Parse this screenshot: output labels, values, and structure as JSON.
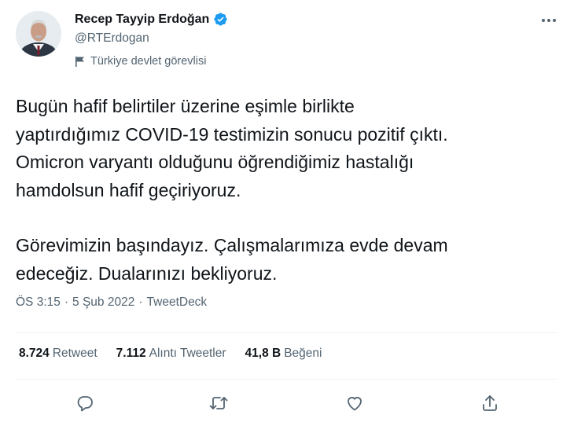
{
  "author": {
    "display_name": "Recep Tayyip Erdoğan",
    "handle": "@RTErdogan",
    "label": "Türkiye devlet görevlisi",
    "verified_icon": "verified-badge-icon",
    "label_icon": "flag-icon"
  },
  "tweet": {
    "lines_p1": [
      "Bugün hafif belirtiler üzerine eşimle birlikte",
      "yaptırdığımız COVID-19 testimizin sonucu pozitif çıktı.",
      "Omicron varyantı olduğunu öğrendiğimiz hastalığı",
      "hamdolsun hafif geçiriyoruz."
    ],
    "lines_p2": [
      "Görevimizin başındayız. Çalışmalarımıza evde devam",
      "edeceğiz. Dualarınızı bekliyoruz."
    ]
  },
  "meta": {
    "time": "ÖS 3:15",
    "separator": "·",
    "date": "5 Şub 2022",
    "source": "TweetDeck"
  },
  "stats": {
    "retweets_count": "8.724",
    "retweets_label": "Retweet",
    "quotes_count": "7.112",
    "quotes_label": "Alıntı Tweetler",
    "likes_count": "41,8 B",
    "likes_label": "Beğeni"
  },
  "actions": [
    "reply-icon",
    "retweet-icon",
    "like-icon",
    "share-icon"
  ],
  "colors": {
    "text_primary": "#0f1419",
    "text_secondary": "#536471",
    "verified_blue": "#1d9bf0",
    "divider": "#eff3f4"
  }
}
